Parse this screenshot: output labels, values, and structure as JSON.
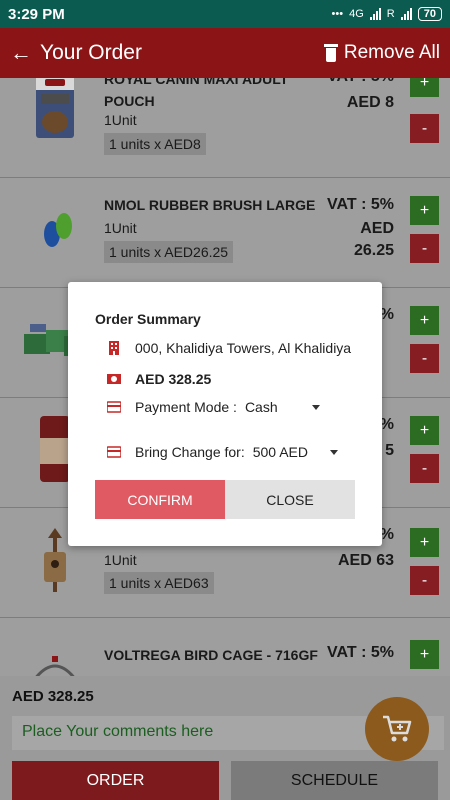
{
  "status_bar": {
    "time": "3:29 PM",
    "dots": "•••",
    "net1": "4G",
    "net2": "R",
    "battery": "70"
  },
  "app_bar": {
    "title": "Your Order",
    "remove_all": "Remove All"
  },
  "items": [
    {
      "name": "ROYAL CANIN MAXI ADULT POUCH",
      "vat": "VAT : 5%",
      "price": "AED 8",
      "unit": "1Unit",
      "qty": "1 units x AED8"
    },
    {
      "name": "NMOL RUBBER BRUSH LARGE",
      "vat": "VAT : 5%",
      "price": "AED 26.25",
      "unit": "1Unit",
      "qty": "1 units x AED26.25"
    },
    {
      "vat": "%"
    },
    {
      "vat": "%",
      "price": "5"
    },
    {
      "vat": "%",
      "price": "AED 63",
      "unit": "1Unit",
      "qty": "1 units x AED63"
    },
    {
      "name": "VOLTREGA BIRD CAGE - 716GF",
      "vat": "VAT : 5%"
    }
  ],
  "buttons": {
    "plus": "+",
    "minus": "-"
  },
  "summary": {
    "title": "Order Summary",
    "address": "000, Khalidiya Towers, Al Khalidiya",
    "amount": "AED 328.25",
    "payment_label": "Payment Mode :",
    "payment_value": "Cash",
    "change_label": "Bring Change for:",
    "change_value": "500 AED",
    "confirm": "CONFIRM",
    "close": "CLOSE"
  },
  "footer": {
    "total": "AED 328.25",
    "comments_placeholder": "Place Your comments here",
    "order": "ORDER",
    "schedule": "SCHEDULE"
  },
  "colors": {
    "status_bar": "#0b5b50",
    "app_bar": "#8b1516",
    "plus": "#2b6b22",
    "minus": "#861d22",
    "confirm": "#e05a63",
    "fab": "#8b5a1c"
  }
}
